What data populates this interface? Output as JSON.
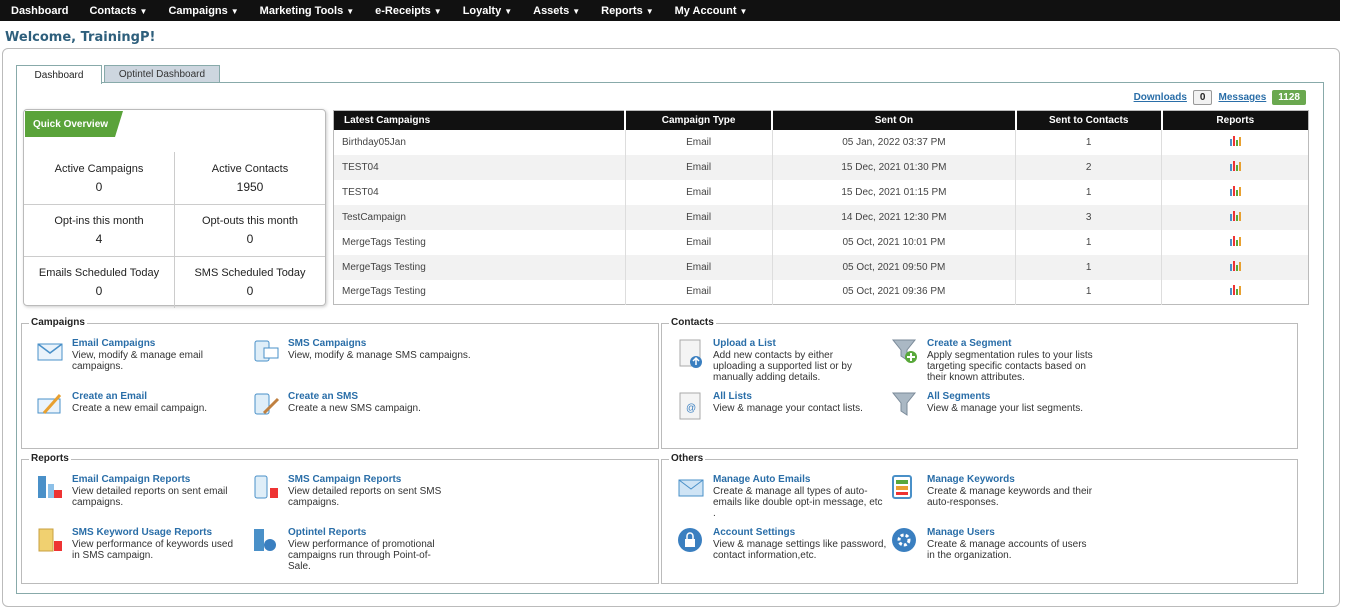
{
  "nav": [
    {
      "label": "Dashboard",
      "caret": false
    },
    {
      "label": "Contacts",
      "caret": true
    },
    {
      "label": "Campaigns",
      "caret": true
    },
    {
      "label": "Marketing Tools",
      "caret": true
    },
    {
      "label": "e-Receipts",
      "caret": true
    },
    {
      "label": "Loyalty",
      "caret": true
    },
    {
      "label": "Assets",
      "caret": true
    },
    {
      "label": "Reports",
      "caret": true
    },
    {
      "label": "My Account",
      "caret": true
    }
  ],
  "welcome": "Welcome, TrainingP!",
  "tabs": {
    "dashboard": "Dashboard",
    "optintel": "Optintel Dashboard"
  },
  "downloads": {
    "label": "Downloads",
    "count": "0"
  },
  "messages": {
    "label": "Messages",
    "count": "1128"
  },
  "overview": {
    "title": "Quick Overview",
    "stats": [
      {
        "label": "Active Campaigns",
        "value": "0"
      },
      {
        "label": "Active Contacts",
        "value": "1950"
      },
      {
        "label": "Opt-ins this month",
        "value": "4"
      },
      {
        "label": "Opt-outs this month",
        "value": "0"
      },
      {
        "label": "Emails Scheduled Today",
        "value": "0"
      },
      {
        "label": "SMS Scheduled Today",
        "value": "0"
      }
    ]
  },
  "campaigns_table": {
    "headers": [
      "Latest Campaigns",
      "Campaign Type",
      "Sent On",
      "Sent to Contacts",
      "Reports"
    ],
    "rows": [
      [
        "Birthday05Jan",
        "Email",
        "05 Jan, 2022 03:37 PM",
        "1"
      ],
      [
        "TEST04",
        "Email",
        "15 Dec, 2021 01:30 PM",
        "2"
      ],
      [
        "TEST04",
        "Email",
        "15 Dec, 2021 01:15 PM",
        "1"
      ],
      [
        "TestCampaign",
        "Email",
        "14 Dec, 2021 12:30 PM",
        "3"
      ],
      [
        "MergeTags Testing",
        "Email",
        "05 Oct, 2021 10:01 PM",
        "1"
      ],
      [
        "MergeTags Testing",
        "Email",
        "05 Oct, 2021 09:50 PM",
        "1"
      ],
      [
        "MergeTags Testing",
        "Email",
        "05 Oct, 2021 09:36 PM",
        "1"
      ]
    ],
    "report_icon": "bar-chart-icon"
  },
  "sections": {
    "campaigns": {
      "title": "Campaigns",
      "items": [
        {
          "title": "Email Campaigns",
          "desc": "View, modify & manage email campaigns.",
          "icon": "email-icon"
        },
        {
          "title": "SMS Campaigns",
          "desc": "View, modify & manage SMS campaigns.",
          "icon": "sms-icon"
        },
        {
          "title": "Create an Email",
          "desc": "Create a new email campaign.",
          "icon": "create-email-icon"
        },
        {
          "title": "Create an SMS",
          "desc": "Create a new SMS campaign.",
          "icon": "create-sms-icon"
        }
      ]
    },
    "contacts": {
      "title": "Contacts",
      "items": [
        {
          "title": "Upload a List",
          "desc": "Add new contacts by either uploading a supported list or by manually adding details.",
          "icon": "upload-list-icon"
        },
        {
          "title": "Create a Segment",
          "desc": "Apply segmentation rules to your lists targeting specific contacts based on their known attributes.",
          "icon": "funnel-plus-icon"
        },
        {
          "title": "All Lists",
          "desc": "View & manage your contact lists.",
          "icon": "lists-icon"
        },
        {
          "title": "All Segments",
          "desc": "View & manage your list segments.",
          "icon": "funnel-icon"
        }
      ]
    },
    "reports": {
      "title": "Reports",
      "items": [
        {
          "title": "Email Campaign Reports",
          "desc": "View detailed reports on sent email campaigns.",
          "icon": "email-report-icon"
        },
        {
          "title": "SMS Campaign Reports",
          "desc": "View detailed reports on sent SMS campaigns.",
          "icon": "sms-report-icon"
        },
        {
          "title": "SMS Keyword Usage Reports",
          "desc": "View performance of keywords used in SMS campaign.",
          "icon": "keyword-report-icon"
        },
        {
          "title": "Optintel Reports",
          "desc": "View performance of promotional campaigns run through Point-of-Sale.",
          "icon": "optintel-report-icon"
        }
      ]
    },
    "others": {
      "title": "Others",
      "items": [
        {
          "title": "Manage Auto Emails",
          "desc": "Create & manage all types of auto-emails like double opt-in message, etc .",
          "icon": "auto-email-icon"
        },
        {
          "title": "Manage Keywords",
          "desc": "Create & manage keywords and their auto-responses.",
          "icon": "keywords-icon"
        },
        {
          "title": "Account Settings",
          "desc": "View & manage settings like password, contact information,etc.",
          "icon": "lock-icon"
        },
        {
          "title": "Manage Users",
          "desc": "Create & manage accounts of users in the organization.",
          "icon": "users-gear-icon"
        }
      ]
    }
  },
  "colors": {
    "nav_bg": "#111111",
    "link": "#2a6ea8",
    "green": "#5aa33a",
    "welcome": "#2e5f7c"
  }
}
